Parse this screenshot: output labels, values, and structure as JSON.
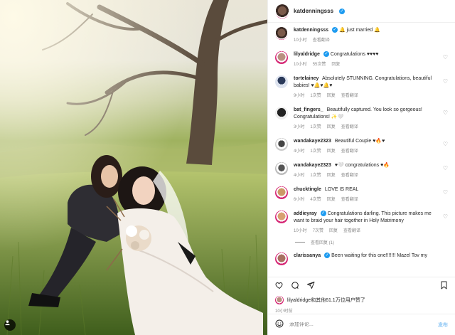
{
  "author": {
    "username": "katdenningsss"
  },
  "caption": {
    "username": "katdenningsss",
    "text": "🔔 just married 🔔",
    "time": "10小时",
    "translate": "查看翻译"
  },
  "comments": [
    {
      "username": "lilyaldridge",
      "verified": true,
      "text": "Congratulations ♥♥♥♥",
      "time": "10小时",
      "likes": "55次赞",
      "reply": "回复"
    },
    {
      "username": "tortelainey",
      "verified": false,
      "text": "Absolutely STUNNING. Congratulations, beautiful babies! ♥🔔♥🔔♥",
      "time": "9小时",
      "likes": "1次赞",
      "reply": "回复",
      "translate": "查看翻译"
    },
    {
      "username": "bat_fingers_",
      "verified": false,
      "text": "Beautifully captured. You look so gorgeous! Congratulations! ✨🤍",
      "time": "3小时",
      "likes": "1次赞",
      "reply": "回复",
      "translate": "查看翻译"
    },
    {
      "username": "wandakaye2323",
      "verified": false,
      "text": "Beautiful Couple ♥🔥♥",
      "time": "4小时",
      "likes": "1次赞",
      "reply": "回复",
      "translate": "查看翻译"
    },
    {
      "username": "wandakaye2323",
      "verified": false,
      "text": "♥🤍 congratulations ♥🔥",
      "time": "4小时",
      "likes": "1次赞",
      "reply": "回复",
      "translate": "查看翻译"
    },
    {
      "username": "chucktingle",
      "verified": false,
      "text": "LOVE IS REAL",
      "time": "6小时",
      "likes": "4次赞",
      "reply": "回复",
      "translate": "查看翻译"
    },
    {
      "username": "addieyray",
      "verified": true,
      "text": "Congratulations darling. This picture makes me want to braid your hair together in Holy Matrimony",
      "time": "10小时",
      "likes": "7次赞",
      "reply": "回复",
      "translate": "查看翻译"
    },
    {
      "username": "clarissanya",
      "verified": true,
      "text": "Been waiting for this one!!!!!!! Mazel Tov my",
      "time": "",
      "likes": "",
      "reply": "",
      "translate": ""
    }
  ],
  "more_replies": "查看回复 (1)",
  "likes_line": "lilyaldridge和其他61.1万位用户赞了",
  "post_time": "10小时前",
  "add_comment_placeholder": "添加评论...",
  "post_button": "发布",
  "icons": [
    "heart-icon",
    "comment-icon",
    "share-icon",
    "bookmark-icon",
    "emoji-icon",
    "user-tag-icon"
  ],
  "colors": {
    "verified": "#1d9bf0",
    "post_button": "#8ec7f5",
    "meta": "#8e8e8e"
  }
}
